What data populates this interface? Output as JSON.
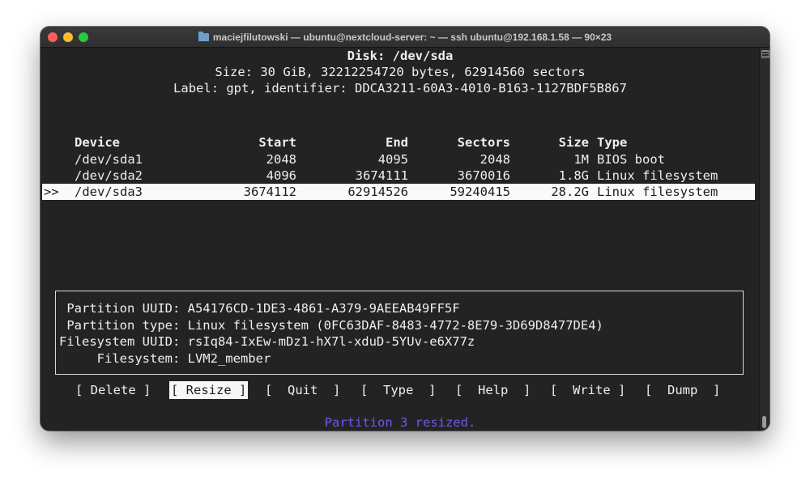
{
  "window": {
    "title": "maciejfilutowski — ubuntu@nextcloud-server: ~ — ssh ubuntu@192.168.1.58 — 90×23"
  },
  "disk": {
    "heading": "Disk: /dev/sda",
    "size_line": "Size: 30 GiB, 32212254720 bytes, 62914560 sectors",
    "label_line": "Label: gpt, identifier: DDCA3211-60A3-4010-B163-1127BDF5B867"
  },
  "table": {
    "headers": [
      "Device",
      "Start",
      "End",
      "Sectors",
      "Size",
      "Type"
    ],
    "rows": [
      {
        "marker": "",
        "device": "/dev/sda1",
        "start": "2048",
        "end": "4095",
        "sectors": "2048",
        "size": "1M",
        "type": "BIOS boot"
      },
      {
        "marker": "",
        "device": "/dev/sda2",
        "start": "4096",
        "end": "3674111",
        "sectors": "3670016",
        "size": "1.8G",
        "type": "Linux filesystem"
      },
      {
        "marker": ">>",
        "device": "/dev/sda3",
        "start": "3674112",
        "end": "62914526",
        "sectors": "59240415",
        "size": "28.2G",
        "type": "Linux filesystem"
      }
    ]
  },
  "info": {
    "line1": " Partition UUID: A54176CD-1DE3-4861-A379-9AEEAB49FF5F",
    "line2": " Partition type: Linux filesystem (0FC63DAF-8483-4772-8E79-3D69D8477DE4)",
    "line3": "Filesystem UUID: rsIq84-IxEw-mDz1-hX7l-xduD-5YUv-e6X77z",
    "line4": "     Filesystem: LVM2_member"
  },
  "menu": {
    "delete": "[ Delete ]",
    "resize": "[ Resize ]",
    "quit": "[  Quit  ]",
    "type": "[  Type  ]",
    "help": "[  Help  ]",
    "write": "[  Write ]",
    "dump": "[  Dump  ]"
  },
  "status": "Partition 3 resized.",
  "colors": {
    "terminal_bg": "#232323",
    "text": "#efefef",
    "status": "#6e58f0",
    "selection_bg": "#fafafa"
  }
}
